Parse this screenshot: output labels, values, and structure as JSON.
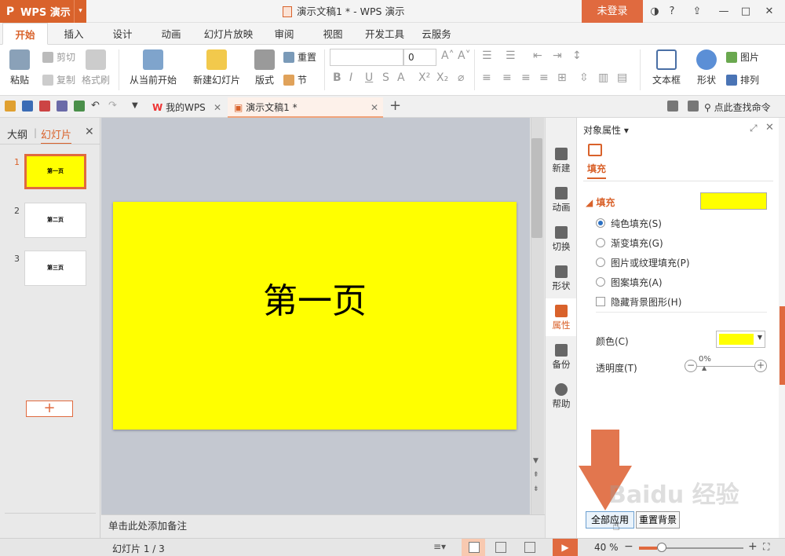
{
  "app": {
    "logo": "P",
    "name": "WPS 演示",
    "dropdown": "▾"
  },
  "window": {
    "title": "演示文稿1 * - WPS 演示",
    "login_label": "未登录",
    "controls": {
      "skin": "◑",
      "help": "?",
      "up": "⇪",
      "minimize": "—",
      "maximize": "□",
      "close": "✕"
    }
  },
  "menu_tabs": [
    "开始",
    "插入",
    "设计",
    "动画",
    "幻灯片放映",
    "审阅",
    "视图",
    "开发工具",
    "云服务"
  ],
  "ribbon": {
    "paste": "粘贴",
    "cut": "剪切",
    "copy": "复制",
    "format_painter": "格式刷",
    "from_current": "从当前开始",
    "new_slide": "新建幻灯片",
    "layout": "版式",
    "reset": "重置",
    "section": "节",
    "font_size": "0",
    "text_box": "文本框",
    "shape": "形状",
    "picture": "图片",
    "arrange": "排列"
  },
  "doc_tabs": [
    {
      "label": "我的WPS"
    },
    {
      "label": "演示文稿1 *"
    }
  ],
  "find_command": "点此查找命令",
  "left_panel": {
    "tab_outline": "大纲",
    "tab_slides": "幻灯片",
    "slides": [
      {
        "num": "1",
        "text": "第一页"
      },
      {
        "num": "2",
        "text": "第二页"
      },
      {
        "num": "3",
        "text": "第三页"
      }
    ],
    "add_label": "+"
  },
  "slide": {
    "title": "第一页",
    "background": "#ffff00"
  },
  "notes_placeholder": "单击此处添加备注",
  "side_strip": [
    "新建",
    "动画",
    "切换",
    "形状",
    "属性",
    "备份",
    "帮助"
  ],
  "properties": {
    "header": "对象属性 ▾",
    "tab": "填充",
    "section": "填充",
    "fill_color": "#ffff00",
    "options": [
      "纯色填充(S)",
      "渐变填充(G)",
      "图片或纹理填充(P)",
      "图案填充(A)"
    ],
    "hide_bg_graphics": "隐藏背景图形(H)",
    "color_label": "颜色(C)",
    "transparency_label": "透明度(T)",
    "transparency_value": "0%",
    "apply_all": "全部应用",
    "reset_bg": "重置背景"
  },
  "statusbar": {
    "slide_info": "幻灯片 1 / 3",
    "zoom": "40 %",
    "zoom_fraction": 0.4
  },
  "watermark": "Baidu 经验",
  "colors": {
    "accent": "#d9622b",
    "arrow": "#e06a3f"
  }
}
